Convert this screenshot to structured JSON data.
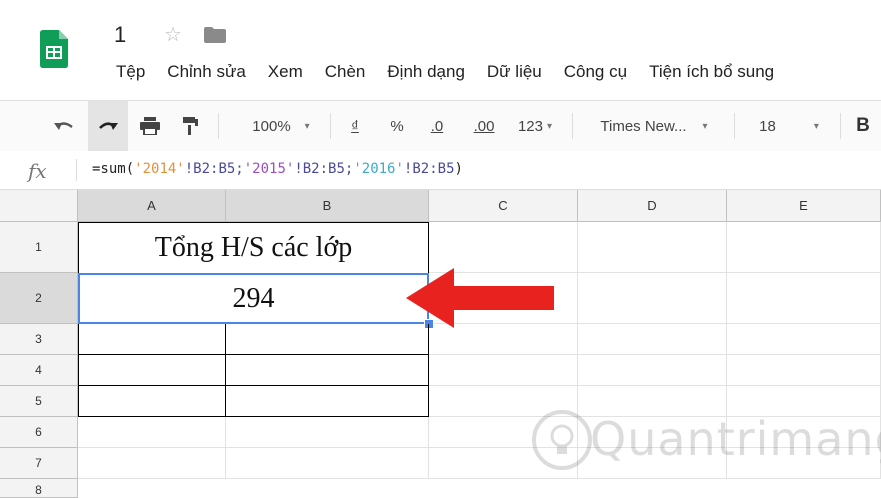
{
  "doc": {
    "title": "1"
  },
  "menu": [
    "Tệp",
    "Chỉnh sửa",
    "Xem",
    "Chèn",
    "Định dạng",
    "Dữ liệu",
    "Công cụ",
    "Tiện ích bổ sung"
  ],
  "toolbar": {
    "zoom": "100%",
    "currency": "₫",
    "percent": "%",
    "dec_less": ".0",
    "dec_more": ".00",
    "format": "123",
    "font": "Times New...",
    "size": "18",
    "bold": "B"
  },
  "formula_bar": {
    "fx": "fx",
    "parts": [
      "=sum(",
      "'2014'",
      "!B2:B5;",
      "'2015'",
      "!B2:B5;",
      "'2016'",
      "!B2:B5",
      ")"
    ]
  },
  "columns": [
    "A",
    "B",
    "C",
    "D",
    "E"
  ],
  "rows": [
    "1",
    "2",
    "3",
    "4",
    "5",
    "6",
    "7",
    "8"
  ],
  "cells": {
    "a1": "Tổng H/S các lớp",
    "a2": "294"
  },
  "colors": {
    "ref_2014": "#e69138",
    "ref_2015": "#9a4fbf",
    "ref_2016": "#3fa9c9",
    "ref_range": "#4a4a9a",
    "selection": "#4a86e8",
    "arrow": "#e8231f",
    "logo": "#0f9d58"
  },
  "watermark": "Quantrimang"
}
